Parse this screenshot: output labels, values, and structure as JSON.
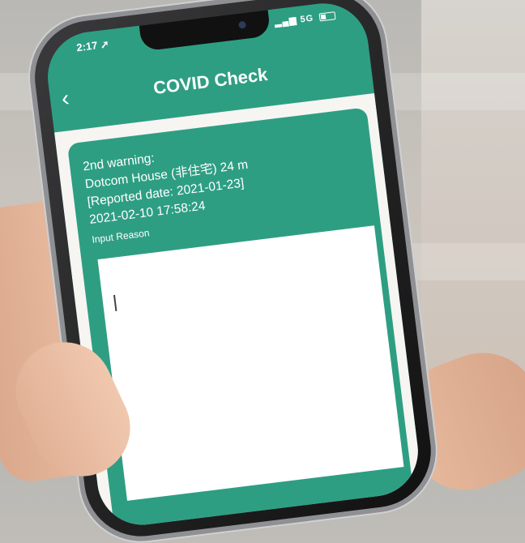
{
  "status_bar": {
    "time": "2:17",
    "network": "5G"
  },
  "header": {
    "back_icon": "chevron-left-icon",
    "title": "COVID Check"
  },
  "warning": {
    "line1": "2nd warning:",
    "line2": "Dotcom House (非住宅) 24 m",
    "line3": "[Reported date: 2021-01-23]",
    "line4": "2021-02-10 17:58:24",
    "reason_label": "Input Reason"
  },
  "reason_input": {
    "value": ""
  },
  "colors": {
    "accent": "#2e9e83",
    "background": "#f6f5f2"
  }
}
